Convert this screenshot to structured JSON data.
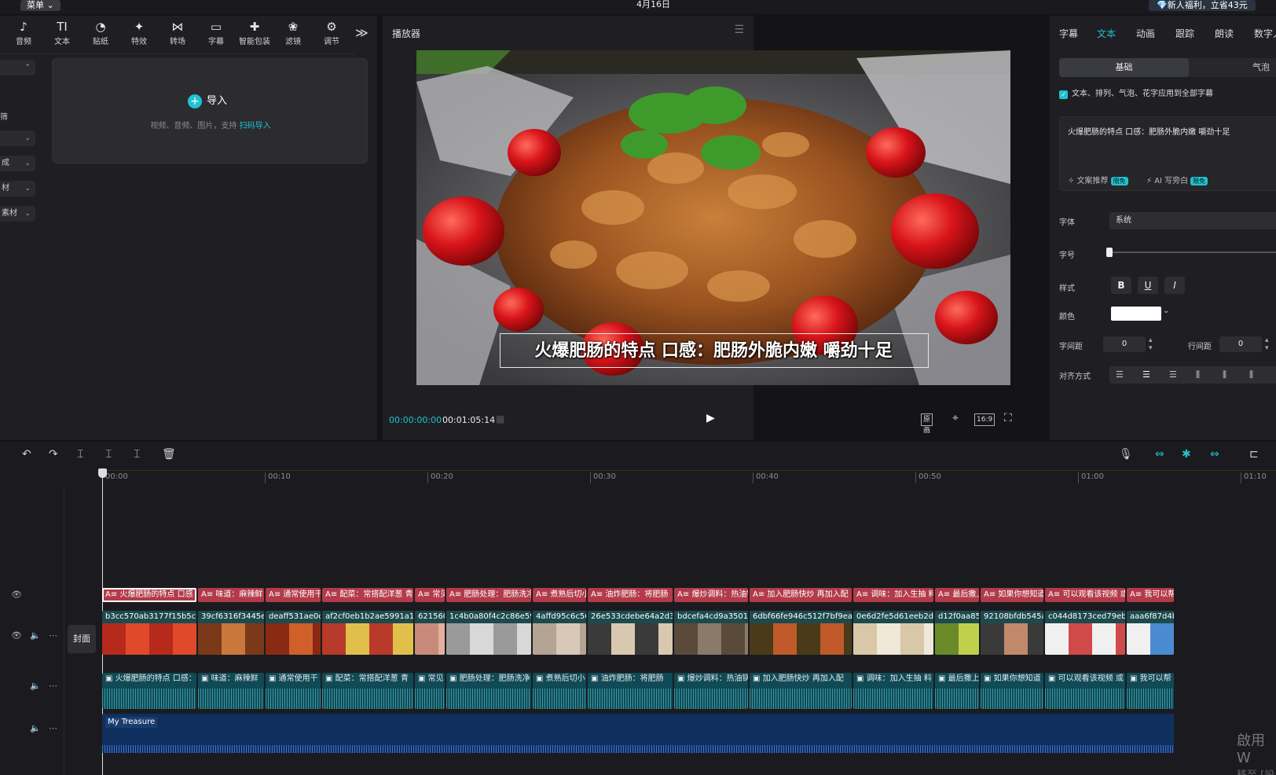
{
  "topbar": {
    "menu_label": "菜单 ⌄",
    "date": "4月16日",
    "promo": "💎新人福利，立省43元"
  },
  "toolbar": {
    "items": [
      {
        "label": "音频",
        "icon": "music-icon"
      },
      {
        "label": "文本",
        "icon": "text-icon"
      },
      {
        "label": "贴纸",
        "icon": "sticker-icon"
      },
      {
        "label": "特效",
        "icon": "effects-icon"
      },
      {
        "label": "转场",
        "icon": "transition-icon"
      },
      {
        "label": "字幕",
        "icon": "subtitle-icon"
      },
      {
        "label": "智能包装",
        "icon": "smart-pack-icon"
      },
      {
        "label": "滤镜",
        "icon": "filter-icon"
      },
      {
        "label": "调节",
        "icon": "adjust-icon"
      }
    ],
    "more": "≫"
  },
  "leftside": {
    "items": [
      {
        "label": ""
      },
      {
        "label": "筛"
      },
      {
        "label": ""
      },
      {
        "label": "成"
      },
      {
        "label": "材"
      },
      {
        "label": "素材"
      }
    ]
  },
  "import": {
    "button_label": "导入",
    "hint_text": "视频、音频、图片，支持",
    "hint_link": "扫码导入"
  },
  "player": {
    "title": "播放器",
    "subtitle": "火爆肥肠的特点 口感：肥肠外脆内嫩 嚼劲十足",
    "current_time": "00:00:00:00",
    "total_time": "00:01:05:14",
    "btn_original": "原画",
    "btn_ratio": "16:9"
  },
  "rightpanel": {
    "tabs": [
      {
        "label": "字幕"
      },
      {
        "label": "文本"
      },
      {
        "label": "动画"
      },
      {
        "label": "跟踪"
      },
      {
        "label": "朗读"
      },
      {
        "label": "数字人"
      }
    ],
    "active_tab": "文本",
    "seg_basic": "基础",
    "seg_bubble": "气泡",
    "apply_all": "文本、排列、气泡、花字应用到全部字幕",
    "text_content": "火爆肥肠的特点 口感：肥肠外脆内嫩 嚼劲十足",
    "ai_recommend": "文案推荐",
    "ai_write": "AI 写旁白",
    "badge": "限免",
    "font_label": "字体",
    "font_value": "系统",
    "size_label": "字号",
    "style_label": "样式",
    "style_b": "B",
    "style_u": "U",
    "style_i": "I",
    "color_label": "颜色",
    "color_value": "#ffffff",
    "spacing_label": "字间距",
    "spacing_value": "0",
    "linespacing_label": "行间距",
    "linespacing_value": "0",
    "align_label": "对齐方式"
  },
  "timeline": {
    "ticks": [
      "00:00",
      "00:10",
      "00:20",
      "00:30",
      "00:40",
      "00:50",
      "01:00",
      "01:10"
    ],
    "cover_label": "封面",
    "subtitles": [
      "火爆肥肠的特点 口感",
      "味道：麻辣鲜",
      "通常使用干",
      "配菜：常搭配洋葱 青",
      "常见",
      "肥肠处理：肥肠洗净",
      "煮熟后切小",
      "油炸肥肠：将肥肠",
      "爆炒调料：热油锅",
      "加入肥肠快炒 再加入配",
      "调味：加入生抽 料",
      "最后撒上",
      "如果你想知道",
      "可以观看该视频 或",
      "我可以帮"
    ],
    "clips": [
      "b3cc570ab3177f15b5c",
      "39cf6316f3445el",
      "deaff531ae0d",
      "af2cf0eb1b2ae5991a1f",
      "621560",
      "1c4b0a80f4c2c86e59",
      "4affd95c6c56",
      "26e533cdebe64a2d3",
      "bdcefa4cd9a3501e",
      "6dbf66fe946c512f7bf9ea1",
      "0e6d2fe5d61eeb2d",
      "d12f0aa85",
      "92108bfdb545a",
      "c044d8173ced79eb9",
      "aaa6f87d4b"
    ],
    "audio": [
      "火爆肥肠的特点 口感：",
      "味道：麻辣鲜",
      "通常使用干",
      "配菜：常搭配洋葱 青",
      "常见",
      "肥肠处理：肥肠洗净",
      "煮熟后切小",
      "油炸肥肠：将肥肠",
      "爆炒调料：热油锅",
      "加入肥肠快炒 再加入配",
      "调味：加入生抽 料",
      "最后撒上",
      "如果你想知道",
      "可以观看该视频 或",
      "我可以帮"
    ],
    "music_label": "My Treasure"
  },
  "watermark": {
    "line1": "啟用 W",
    "line2": "移至 [設"
  }
}
